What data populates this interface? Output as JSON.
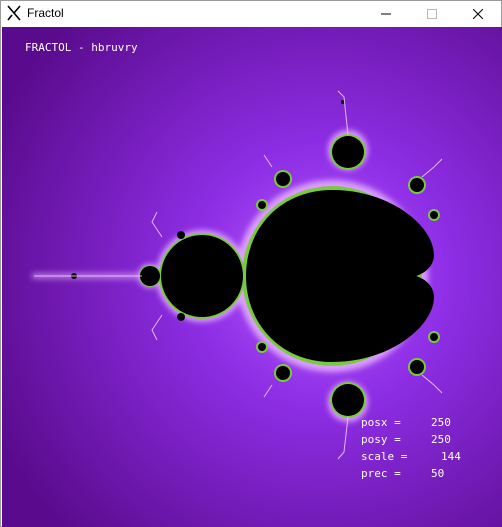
{
  "window": {
    "title": "Fractol",
    "controls": [
      "minimize-icon",
      "maximize-icon",
      "close-icon"
    ]
  },
  "overlay": {
    "header": "FRACTOL - hbruvry",
    "stats": [
      {
        "label": "posx =",
        "value": "250"
      },
      {
        "label": "posy =",
        "value": "250"
      },
      {
        "label": "scale =",
        "value": "144"
      },
      {
        "label": "prec =",
        "value": "50"
      }
    ]
  },
  "colors": {
    "background_outer": "#5b0a8e",
    "background_inner": "#a23bff",
    "set": "#000000",
    "edge_glow": "#e7b8ff",
    "edge_green": "#7ac943"
  }
}
